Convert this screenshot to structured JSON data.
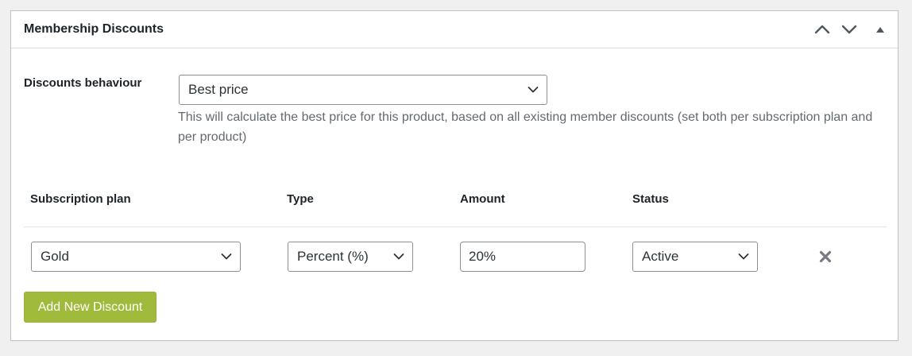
{
  "panel": {
    "title": "Membership Discounts",
    "controls": {
      "move_up_icon": "chevron-up-icon",
      "move_down_icon": "chevron-down-icon",
      "toggle_icon": "triangle-up-icon"
    }
  },
  "behaviour": {
    "label": "Discounts behaviour",
    "selected": "Best price",
    "description": "This will calculate the best price for this product, based on all existing member discounts (set both per subscription plan and per product)"
  },
  "table": {
    "headers": [
      "Subscription plan",
      "Type",
      "Amount",
      "Status"
    ],
    "rows": [
      {
        "plan": "Gold",
        "type": "Percent (%)",
        "amount": "20%",
        "status": "Active",
        "remove_icon": "close-icon"
      }
    ]
  },
  "actions": {
    "add_label": "Add New Discount"
  },
  "colors": {
    "accent_button": "#a0ba3c",
    "border": "#8c8f94",
    "page_bg": "#f0f0f1"
  }
}
